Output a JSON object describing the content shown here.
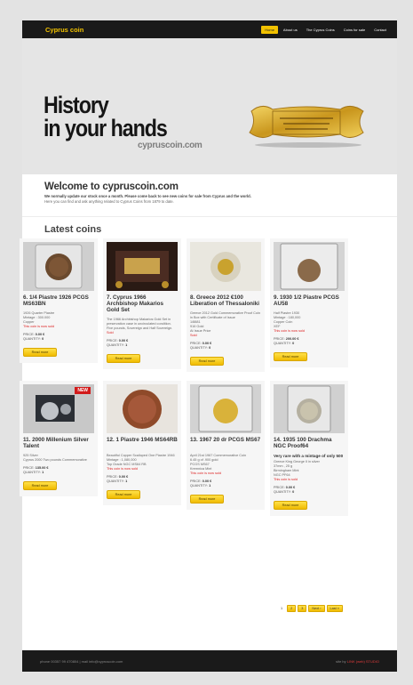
{
  "header": {
    "logo": "Cyprus coin",
    "nav": [
      "Home",
      "About us",
      "The Cyprus Coins",
      "Coins for sale",
      "Contact"
    ]
  },
  "hero": {
    "title_line1": "History",
    "title_line2": "in your hands",
    "domain": "cypruscoin.com"
  },
  "welcome": {
    "title": "Welcome to cypruscoin.com",
    "lead": "We normally update our stock once a month. Please come back to see new coins for sale from Cyprus and the world.",
    "sub": "Here you can find and ask anything related to Cyprus Coins from 1879 to date."
  },
  "latest": {
    "title": "Latest coins"
  },
  "coins": [
    {
      "title": "6. 1/4 Piastre 1926 PCGS MS63BN",
      "desc": "1926 Quarter Piastre\nMintage : 300.000\nCopper",
      "sold": "This coin is now sold",
      "price_label": "PRICE:",
      "price": "0.00 €",
      "qty_label": "QUANTITY:",
      "qty": "0",
      "btn": "Read more"
    },
    {
      "title": "7. Cyprus 1966 Archbishop Makarios Gold Set",
      "desc": "The 1966 Archbishop Makarios Gold Set in preservation case in uncirculated condition.\nFive pounds, Sovereign and Half Sovereign.",
      "sold": "Sold",
      "price_label": "PRICE:",
      "price": "0.00 €",
      "qty_label": "QUANTITY:",
      "qty": "1",
      "btn": "Read more"
    },
    {
      "title": "8. Greece 2012 €100 Liberation of Thessaloniki",
      "desc": "Greece 2012 Gold Commemorative Proof Coin\nin Box with Certificate of Issue\n1/8881\n916 Gold\nAt Issue Price",
      "sold": "Sold",
      "price_label": "PRICE:",
      "price": "0.00 €",
      "qty_label": "QUANTITY:",
      "qty": "0",
      "btn": "Read more"
    },
    {
      "title": "9. 1930 1/2 Piastre PCGS AU58",
      "desc": "Half Piastre 1930\nMintage : 180,000\nCopper Coin\nXEF",
      "sold": "This coin is now sold",
      "price_label": "PRICE:",
      "price": "200.00 €",
      "qty_label": "QUANTITY:",
      "qty": "0",
      "btn": "Read more"
    },
    {
      "title": "11. 2000 Millenium Silver Talent",
      "desc": "925 Silver\nCyprus 2000 Two pounds Commemorative",
      "sold": "",
      "price_label": "PRICE:",
      "price": "135.00 €",
      "qty_label": "QUANTITY:",
      "qty": "1",
      "btn": "Read more",
      "badge": "NEW"
    },
    {
      "title": "12. 1 Piastre 1946 MS64RB",
      "desc": "Beautiful Copper Scalloped One Piastre 1946\nMintage : 1,080,000\nTop Grade NGC MS64 RB",
      "sold": "This coin is now sold",
      "price_label": "PRICE:",
      "price": "0.00 €",
      "qty_label": "QUANTITY:",
      "qty": "1",
      "btn": "Read more"
    },
    {
      "title": "13. 1967 20 dr PCGS MS67",
      "desc": "April 21st 1967 Commemorative Coin\n6.45 g of .900 gold\nPCGS MS67\nKremnica Mint",
      "sold": "This coin is now sold",
      "price_label": "PRICE:",
      "price": "0.00 €",
      "qty_label": "QUANTITY:",
      "qty": "1",
      "btn": "Read more"
    },
    {
      "title": "14. 1935 100 Drachma NGC Proof64",
      "intro": "Very rare with a mintage of only 500",
      "desc": "Greece King George II in silver\n37mm , 25 g\nBirmingham Mint\nNGC PF64",
      "sold": "This coin is sold",
      "price_label": "PRICE:",
      "price": "0.00 €",
      "qty_label": "QUANTITY:",
      "qty": "0",
      "btn": "Read more"
    }
  ],
  "pager": {
    "pages": [
      "1",
      "2",
      "3"
    ],
    "next": "Next ›",
    "last": "Last »"
  },
  "footer": {
    "left": "phone 00357 99 470804  |  mail info@cypruscoin.com",
    "right_prefix": "site by",
    "right_link": "LINK (web) STUDIO"
  }
}
